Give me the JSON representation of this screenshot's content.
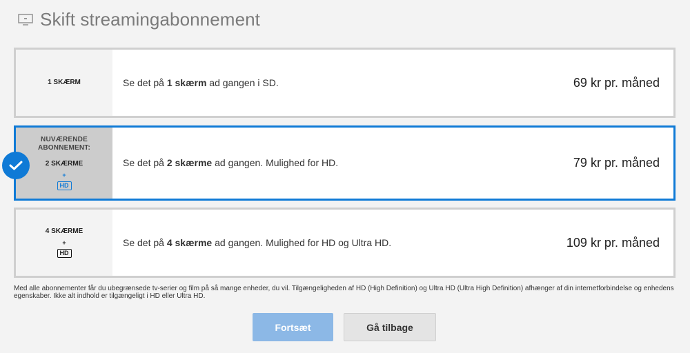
{
  "header": {
    "title": "Skift streamingabonnement",
    "icon": "tv-icon"
  },
  "plans": [
    {
      "screens_label": "1 SKÆRM",
      "desc_pre": "Se det på ",
      "desc_bold": "1 skærm",
      "desc_post": " ad gangen i SD.",
      "price": "69 kr pr. måned",
      "selected": false
    },
    {
      "current_label": "NUVÆRENDE ABONNEMENT:",
      "screens_label": "2 SKÆRME",
      "plus": "+",
      "badge": "HD",
      "desc_pre": "Se det på ",
      "desc_bold": "2 skærme",
      "desc_post": " ad gangen. Mulighed for HD.",
      "price": "79 kr pr. måned",
      "selected": true
    },
    {
      "screens_label": "4 SKÆRME",
      "plus": "+",
      "badge": "HD",
      "desc_pre": "Se det på ",
      "desc_bold": "4 skærme",
      "desc_post": " ad gangen. Mulighed for HD og Ultra HD.",
      "price": "109 kr pr. måned",
      "selected": false
    }
  ],
  "footnote": "Med alle abonnementer får du ubegrænsede tv-serier og film på så mange enheder, du vil. Tilgængeligheden af HD (High Definition) og Ultra HD (Ultra High Definition) afhænger af din internetforbindelse og enhedens egenskaber. Ikke alt indhold er tilgængeligt i HD eller Ultra HD.",
  "buttons": {
    "continue": "Fortsæt",
    "back": "Gå tilbage"
  },
  "colors": {
    "accent": "#0f7ad6",
    "primary_button": "#8cb8e6",
    "background": "#f3f3f3"
  }
}
